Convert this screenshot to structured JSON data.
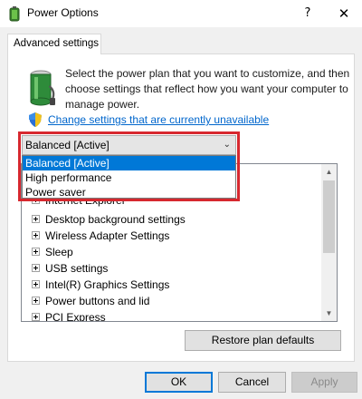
{
  "window": {
    "title": "Power Options",
    "help_label": "?",
    "close_label": "✕"
  },
  "tab": {
    "label": "Advanced settings"
  },
  "description": "Select the power plan that you want to customize, and then choose settings that reflect how you want your computer to manage power.",
  "change_link": "Change settings that are currently unavailable",
  "plan_select": {
    "value": "Balanced [Active]",
    "chevron": "⌄",
    "options": [
      "Balanced [Active]",
      "High performance",
      "Power saver"
    ],
    "selected_index": 0
  },
  "settings_list": {
    "items": [
      "Internet Explorer",
      "Desktop background settings",
      "Wireless Adapter Settings",
      "Sleep",
      "USB settings",
      "Intel(R) Graphics Settings",
      "Power buttons and lid",
      "PCI Express"
    ]
  },
  "scrollbar": {
    "up": "▲",
    "down": "▼"
  },
  "buttons": {
    "restore": "Restore plan defaults",
    "ok": "OK",
    "cancel": "Cancel",
    "apply": "Apply"
  },
  "colors": {
    "highlight_border": "#d7282f",
    "selection": "#0078d7",
    "link": "#0066cc"
  }
}
